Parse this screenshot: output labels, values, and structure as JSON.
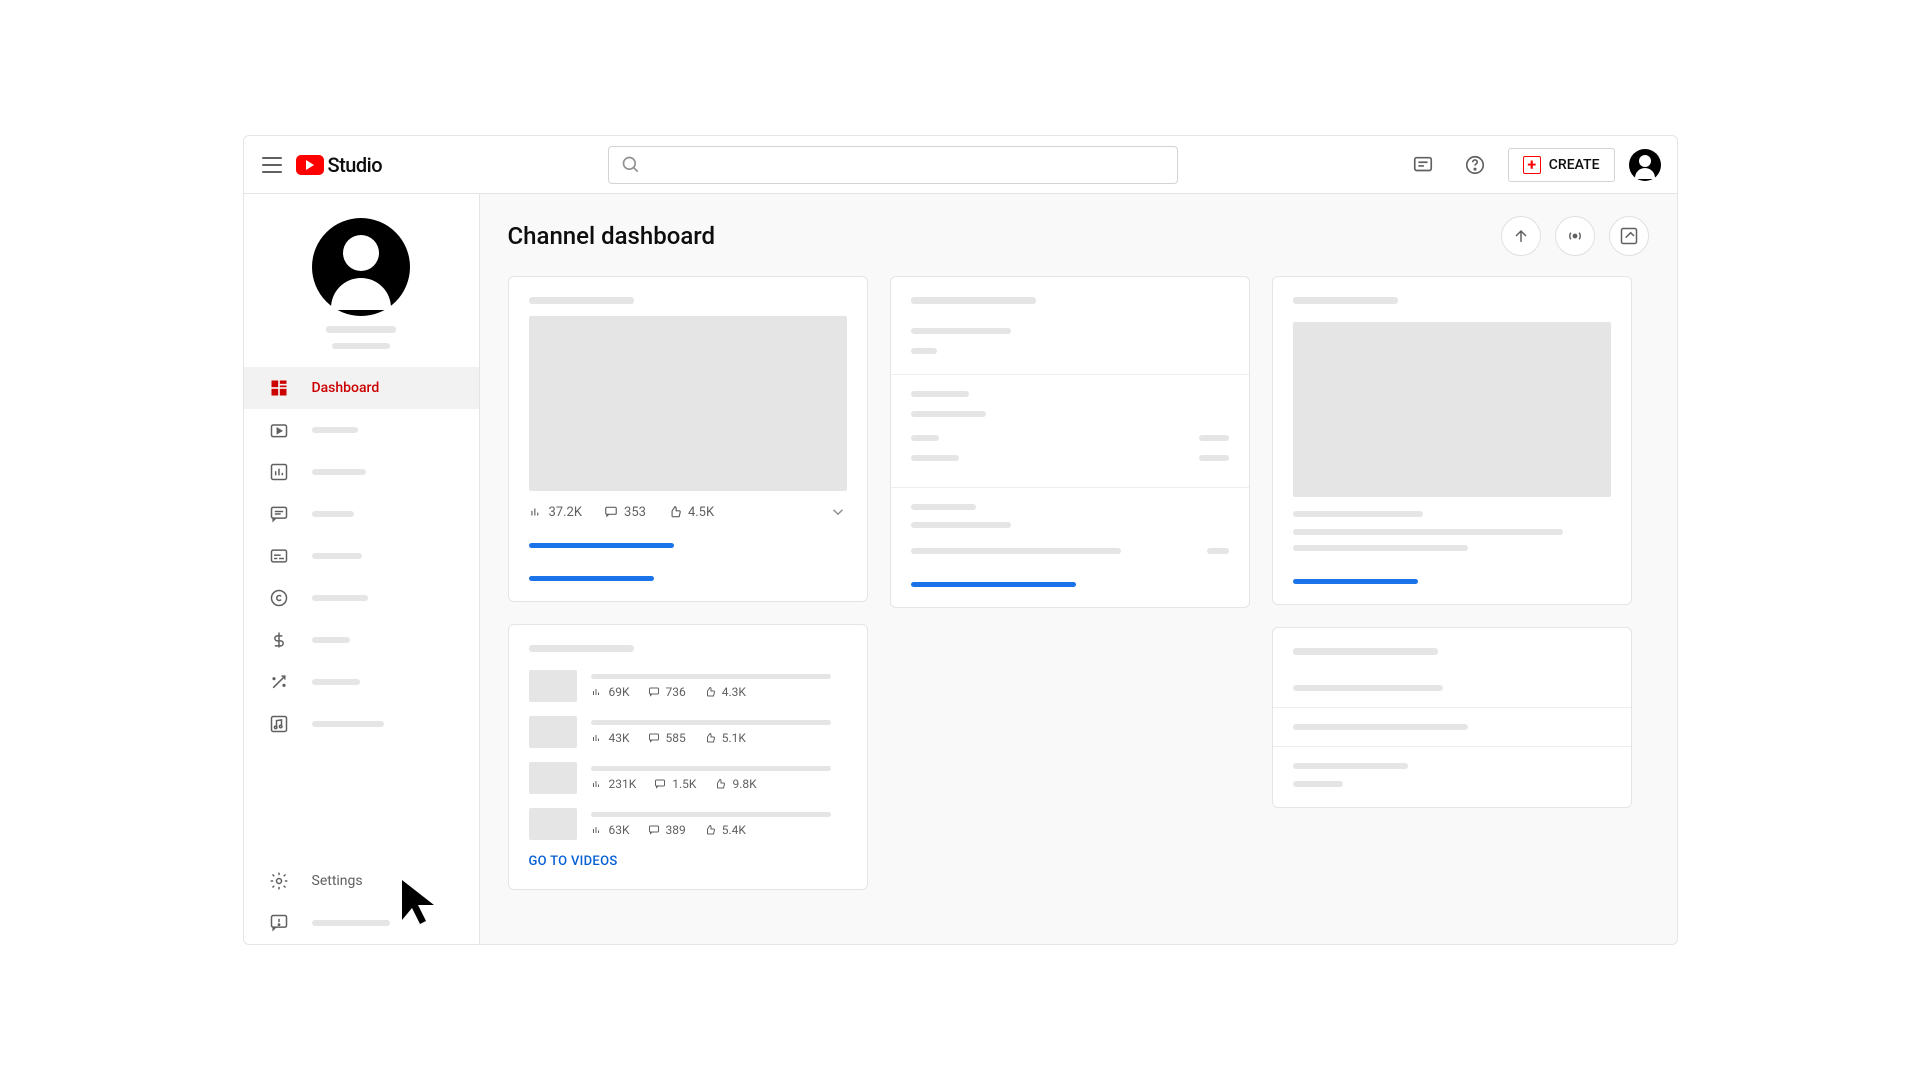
{
  "header": {
    "logo_text": "Studio",
    "create_label": "CREATE",
    "search_placeholder": ""
  },
  "sidebar": {
    "items": [
      {
        "label": "Dashboard"
      }
    ],
    "settings_label": "Settings"
  },
  "page": {
    "title": "Channel dashboard"
  },
  "video_perf": {
    "views": "37.2K",
    "comments": "353",
    "likes": "4.5K"
  },
  "recent_videos": [
    {
      "views": "69K",
      "comments": "736",
      "likes": "4.3K"
    },
    {
      "views": "43K",
      "comments": "585",
      "likes": "5.1K"
    },
    {
      "views": "231K",
      "comments": "1.5K",
      "likes": "9.8K"
    },
    {
      "views": "63K",
      "comments": "389",
      "likes": "5.4K"
    }
  ],
  "links": {
    "go_to_videos": "GO TO VIDEOS"
  }
}
